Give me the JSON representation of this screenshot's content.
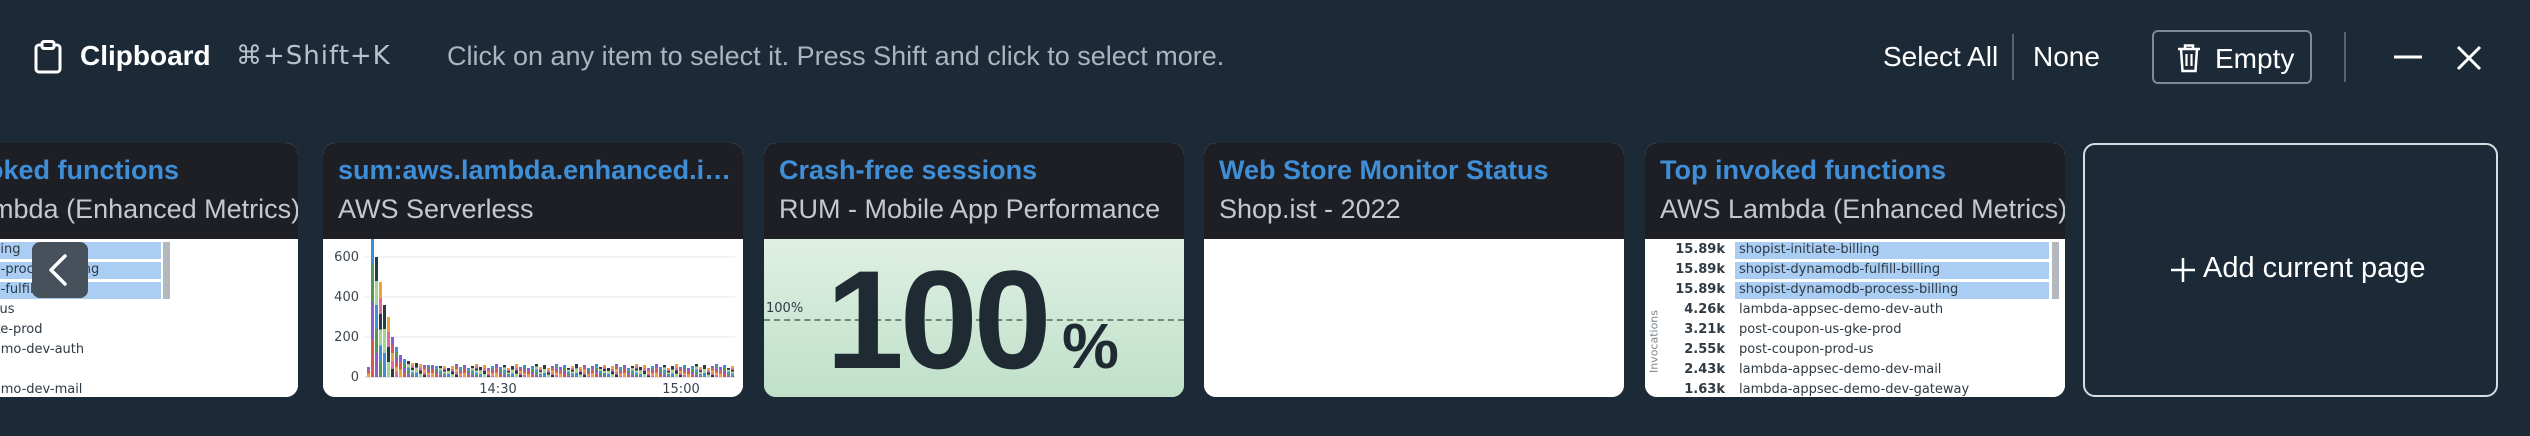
{
  "header": {
    "title": "Clipboard",
    "shortcut": "⌘+Shift+K",
    "hint": "Click on any item to select it. Press Shift and click to select more.",
    "select_all": "Select All",
    "none": "None",
    "empty": "Empty"
  },
  "cards": [
    {
      "title": "Top invoked functions",
      "subtitle": "AWS Lambda (Enhanced Metrics)",
      "rows": [
        "shopist-initiate-billing",
        "shopist-dynamodb-process-billing",
        "shopist-dynamodb-fulfill-billing",
        "post-coupon-prod-us",
        "post-coupon-us-gke-prod",
        "lambda-appsec-demo-dev-auth",
        "fulfill-order-prod",
        "lambda-appsec-demo-dev-mail"
      ],
      "bar_fractions": [
        1,
        1,
        1,
        0,
        0,
        0,
        0,
        0
      ]
    },
    {
      "title": "sum:aws.lambda.enhanced.invocations",
      "subtitle": "AWS Serverless",
      "y_ticks": [
        "600",
        "400",
        "200",
        "0"
      ],
      "x_ticks": [
        "14:30",
        "15:00"
      ]
    },
    {
      "title": "Crash-free sessions",
      "subtitle": "RUM - Mobile App Performance",
      "value": "100",
      "unit": "%",
      "marker": "100%"
    },
    {
      "title": "Web Store Monitor Status",
      "subtitle": "Shop.ist - 2022"
    },
    {
      "title": "Top invoked functions",
      "subtitle": "AWS Lambda (Enhanced Metrics)",
      "axis_label": "Invocations",
      "values": [
        "15.89k",
        "15.89k",
        "15.89k",
        "4.26k",
        "3.21k",
        "2.55k",
        "2.43k",
        "1.63k"
      ],
      "rows": [
        "shopist-initiate-billing",
        "shopist-dynamodb-fulfill-billing",
        "shopist-dynamodb-process-billing",
        "lambda-appsec-demo-dev-auth",
        "post-coupon-us-gke-prod",
        "post-coupon-prod-us",
        "lambda-appsec-demo-dev-mail",
        "lambda-appsec-demo-dev-gateway"
      ],
      "bar_fractions": [
        1,
        1,
        1,
        0,
        0,
        0,
        0,
        0
      ]
    }
  ],
  "add_card": {
    "label": "Add current page"
  },
  "icons": [
    "clipboard-icon",
    "trash-icon",
    "minimize-icon",
    "close-icon",
    "chevron-left-icon",
    "plus-icon"
  ],
  "colors": {
    "background": "#1b2a36",
    "card_header": "#1e1f25",
    "accent": "#3f8fd8",
    "bar": "#a9cdf3",
    "crash_free_bg": "#c7e3d0"
  }
}
